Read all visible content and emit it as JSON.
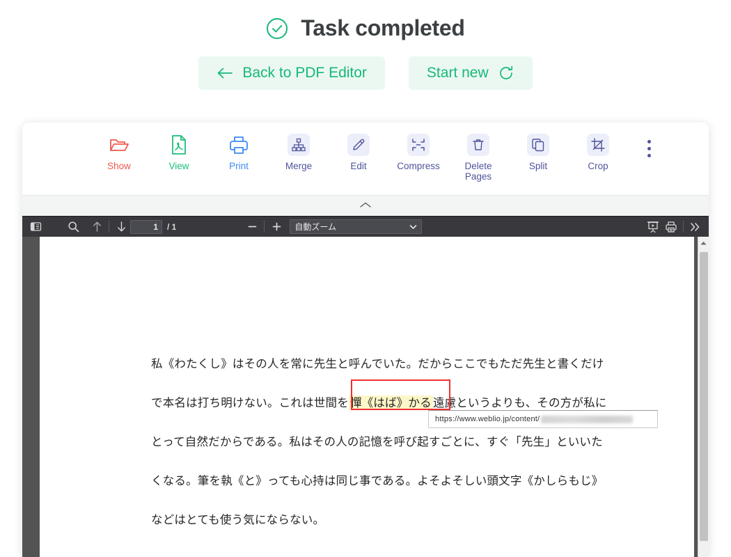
{
  "header": {
    "title": "Task completed",
    "status_icon": "check-circle-icon",
    "accent_green": "#17b877"
  },
  "actions": [
    {
      "id": "back-to-pdf-editor",
      "label": "Back to PDF Editor",
      "icon": "arrow-left-icon",
      "icon_side": "left"
    },
    {
      "id": "start-new",
      "label": "Start new",
      "icon": "refresh-icon",
      "icon_side": "right"
    }
  ],
  "toolbar": {
    "tools": [
      {
        "id": "show",
        "label": "Show",
        "icon": "folder-open-icon",
        "color": "#f05a4f",
        "badged": false
      },
      {
        "id": "view",
        "label": "View",
        "icon": "pdf-file-icon",
        "color": "#1bbf7a",
        "badged": false
      },
      {
        "id": "print",
        "label": "Print",
        "icon": "printer-icon",
        "color": "#3d8bf5",
        "badged": false
      },
      {
        "id": "merge",
        "label": "Merge",
        "icon": "merge-tree-icon",
        "color": "#4f5499",
        "badged": true
      },
      {
        "id": "edit",
        "label": "Edit",
        "icon": "pencil-icon",
        "color": "#4f5499",
        "badged": true
      },
      {
        "id": "compress",
        "label": "Compress",
        "icon": "compress-icon",
        "color": "#4f5499",
        "badged": true
      },
      {
        "id": "delete-pages",
        "label": "Delete\nPages",
        "icon": "trash-icon",
        "color": "#4f5499",
        "badged": true
      },
      {
        "id": "split",
        "label": "Split",
        "icon": "split-copy-icon",
        "color": "#4f5499",
        "badged": true
      },
      {
        "id": "crop",
        "label": "Crop",
        "icon": "crop-icon",
        "color": "#4f5499",
        "badged": true
      }
    ],
    "more_menu_icon": "kebab-menu-icon",
    "collapse_icon": "chevron-up-icon"
  },
  "pdf_viewer": {
    "sidebar_toggle_icon": "sidebar-toggle-icon",
    "search_icon": "search-icon",
    "prev_page_icon": "arrow-up-icon",
    "next_page_icon": "arrow-down-icon",
    "page_number": "1",
    "page_total": "/ 1",
    "zoom_out_icon": "minus-icon",
    "zoom_in_icon": "plus-icon",
    "zoom_value": "自動ズーム",
    "zoom_caret_icon": "chevron-down-icon",
    "presentation_icon": "presentation-mode-icon",
    "print_icon": "printer-icon",
    "more_tools_icon": "double-chevron-right-icon",
    "scroll_up_icon": "scroll-up-arrow-icon"
  },
  "document": {
    "lines": [
      "私《わたくし》はその人を常に先生と呼んでいた。だからここでもただ先生と書くだけ",
      {
        "pre": "で本名は打ち明けない。これは世間を",
        "highlight": "憚《はば》かる",
        "post": "遠慮というよりも、その方が私に"
      },
      "とって自然だからである。私はその人の記憶を呼び起すごとに、すぐ「先生」といいた",
      "くなる。筆を執《と》っても心持は同じ事である。よそよそしい頭文字《かしらもじ》",
      "などはとても使う気にならない。"
    ],
    "highlight_color": "#fdf6c8",
    "selection_border_color": "#ef2f2f"
  },
  "tooltip": {
    "url": "https://www.weblio.jp/content/",
    "redacted": true
  }
}
